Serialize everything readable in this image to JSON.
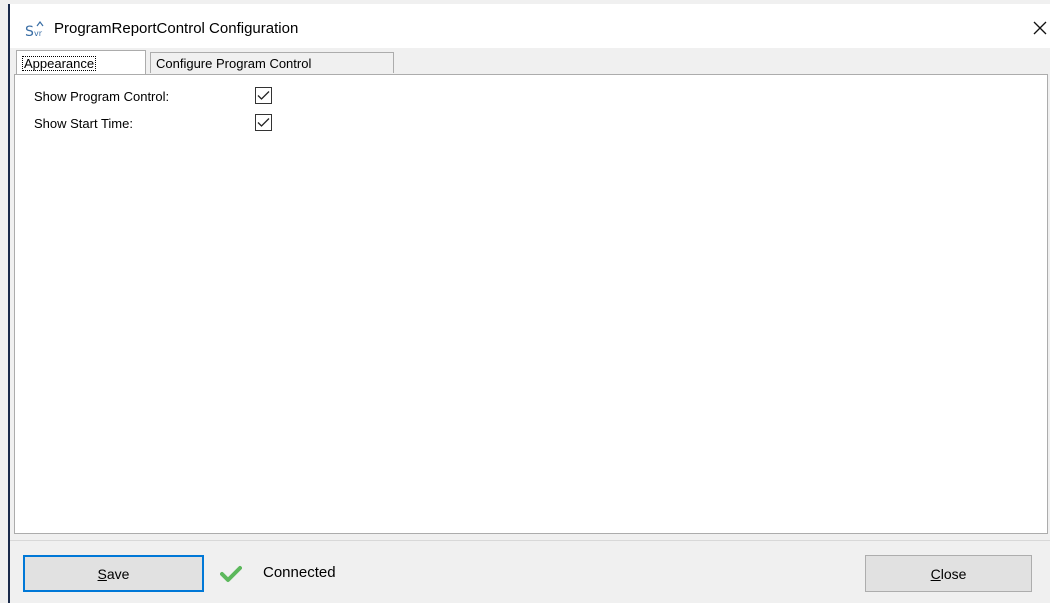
{
  "window": {
    "title": "ProgramReportControl Configuration",
    "icon_label": "Svr"
  },
  "tabs": [
    {
      "label": "Appearance",
      "active": true
    },
    {
      "label": "Configure Program Control",
      "active": false
    }
  ],
  "settings": [
    {
      "label": "Show Program Control:",
      "checked": true
    },
    {
      "label": "Show Start Time:",
      "checked": true
    }
  ],
  "footer": {
    "save_label": "Save",
    "save_mnemonic": "S",
    "save_rest": "ave",
    "status_text": "Connected",
    "close_label": "Close",
    "close_mnemonic": "C",
    "close_rest": "lose"
  },
  "colors": {
    "accent": "#0078d7",
    "status_ok": "#5cb85c"
  }
}
